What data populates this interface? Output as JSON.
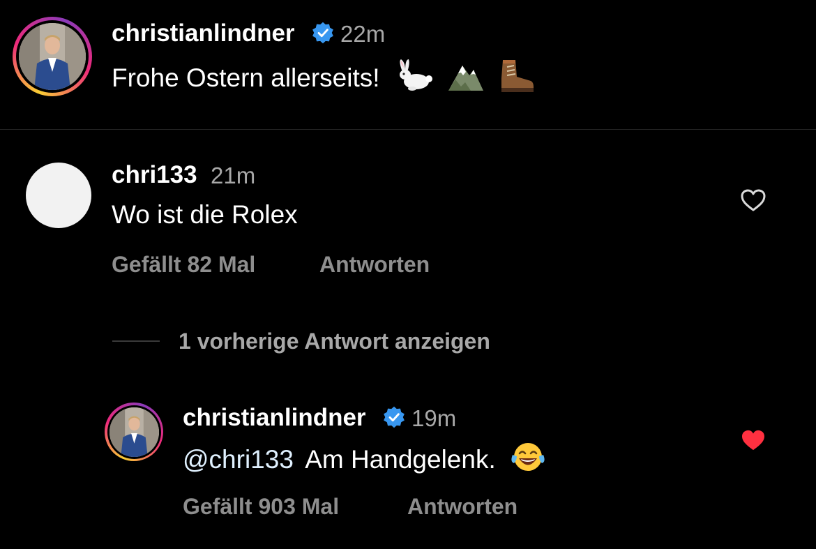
{
  "post": {
    "username": "christianlindner",
    "time": "22m",
    "caption": "Frohe Ostern allerseits!",
    "caption_emojis": [
      "rabbit-emoji",
      "mountain-emoji",
      "hiking-boot-emoji"
    ]
  },
  "comments": [
    {
      "username": "chri133",
      "time": "21m",
      "text": "Wo ist die Rolex",
      "likes_label": "Gefällt 82 Mal",
      "reply_label": "Antworten",
      "liked": false
    }
  ],
  "view_replies_label": "1 vorherige Antwort anzeigen",
  "reply": {
    "username": "christianlindner",
    "time": "19m",
    "mention": "@chri133",
    "text": "Am Handgelenk.",
    "emoji": "face-with-tears-of-joy-emoji",
    "likes_label": "Gefällt 903 Mal",
    "reply_label": "Antworten",
    "liked": true
  },
  "colors": {
    "background": "#000000",
    "verified": "#3897f0",
    "heart_liked": "#ff3040",
    "meta": "#8e8e8e"
  }
}
